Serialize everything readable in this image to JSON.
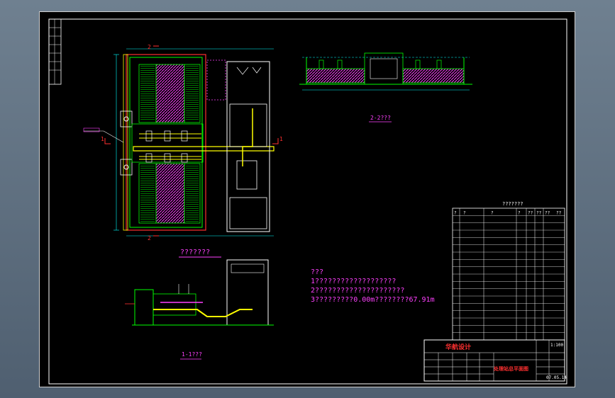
{
  "drawing": {
    "plan_view_title": "???????",
    "section_2_title": "2-2???",
    "section_1_title": "1-1???",
    "section_marker_1": "1",
    "section_marker_2": "2",
    "notes": {
      "heading": "???",
      "line1": "1???????????????????",
      "line2": "2?????????????????????",
      "line3": "3?????????0.00m????????67.91m"
    },
    "materials_table": {
      "title": "???????",
      "header": [
        "?",
        "?",
        "?",
        "?",
        "??",
        "??",
        "??",
        "??"
      ],
      "row_count": 17
    },
    "title_block": {
      "company": "华航设计",
      "drawing_name": "处理站总平面图",
      "scale_label": "1:100",
      "code": "07.05.14"
    }
  },
  "colors": {
    "background": "#000000",
    "frame": "#ffffff",
    "structure": "#00ff00",
    "pipes": "#ffff00",
    "hatch": "#ff40ff",
    "dimension": "#00ffff",
    "annotation": "#ff40ff",
    "title_red": "#ff3030"
  }
}
